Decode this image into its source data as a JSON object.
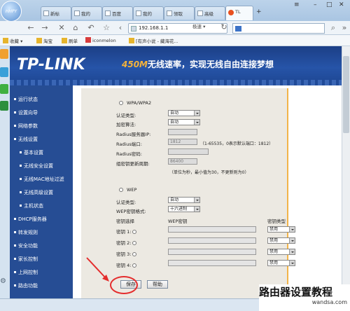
{
  "browser": {
    "logo_text": "HHPY",
    "tabs": [
      {
        "label": "新标"
      },
      {
        "label": "我的"
      },
      {
        "label": "百度"
      },
      {
        "label": "我的"
      },
      {
        "label": "领取"
      },
      {
        "label": "高级"
      },
      {
        "label": "TL",
        "active": true
      }
    ],
    "address": "192.168.1.1",
    "mode": "极速",
    "favorites": [
      "收藏",
      "淘宝",
      "刷单",
      "iconmelon",
      "[有声小说 - 藏海花..."
    ]
  },
  "router": {
    "brand": "TP-LINK",
    "slogan_number": "450M",
    "slogan_text": "无线速率，实现无线自由连接梦想",
    "menu": [
      "运行状态",
      "设置向导",
      "网络参数",
      "无线设置",
      "基本设置",
      "无线安全设置",
      "无线MAC地址过滤",
      "无线高级设置",
      "主机状态",
      "DHCP服务器",
      "转发规则",
      "安全功能",
      "家长控制",
      "上网控制",
      "路由功能"
    ],
    "wpa": {
      "title": "WPA/WPA2",
      "auth_label": "认证类型:",
      "auth_value": "自动",
      "enc_label": "加密算法:",
      "enc_value": "自动",
      "radius_ip_label": "Radius服务器IP:",
      "radius_port_label": "Radius端口:",
      "radius_port_value": "1812",
      "radius_port_hint": "（1-65535，0表示默认端口：1812）",
      "radius_pwd_label": "Radius密码:",
      "group_key_label": "组密钥更新周期:",
      "group_key_value": "86400",
      "group_key_hint": "（单位为秒，最小值为30，不更新则为0）"
    },
    "wep": {
      "title": "WEP",
      "auth_label": "认证类型:",
      "auth_value": "自动",
      "format_label": "WEP密钥格式:",
      "format_value": "十六进制",
      "col_select": "密钥选择",
      "col_key": "WEP密钥",
      "col_type": "密钥类型",
      "keys": [
        {
          "label": "密钥 1:",
          "type": "禁用"
        },
        {
          "label": "密钥 2:",
          "type": "禁用"
        },
        {
          "label": "密钥 3:",
          "type": "禁用"
        },
        {
          "label": "密钥 4:",
          "type": "禁用"
        }
      ]
    },
    "save_label": "保存",
    "help_label": "帮助"
  },
  "watermark": {
    "title": "路由器设置教程",
    "url": "wandsa.com"
  }
}
